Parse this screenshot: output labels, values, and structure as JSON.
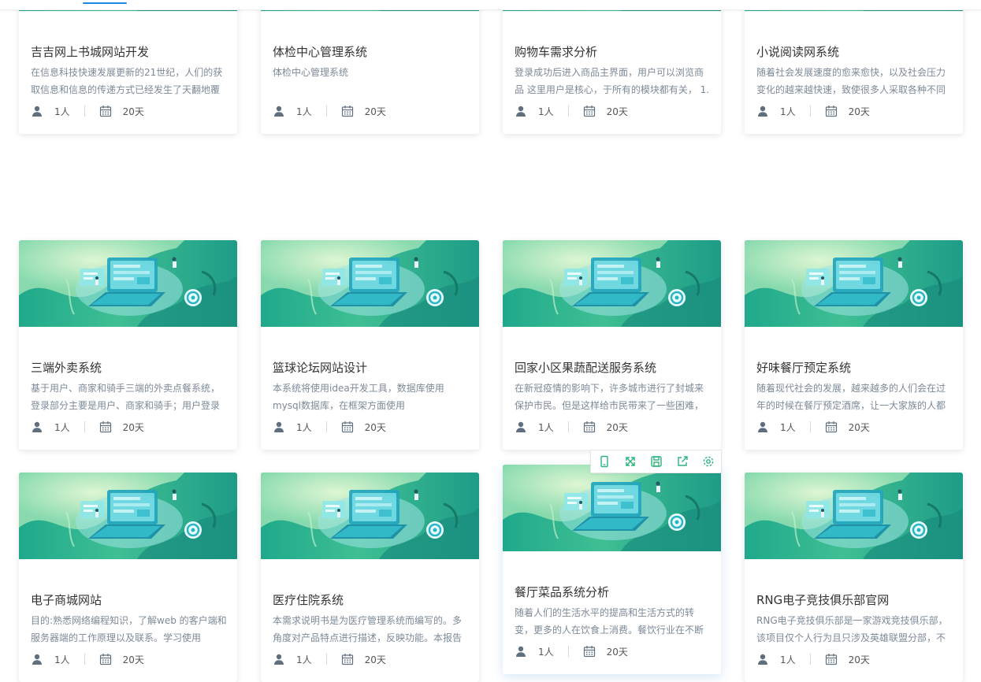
{
  "colors": {
    "accent": "#1e88e5",
    "banner_teal": "#21a98c",
    "banner_light": "#b7ecc6",
    "title_text": "#333333",
    "desc_text": "#7d8a97",
    "toolbar_icon": "#2bb37d"
  },
  "meta_icons": {
    "members": "user-icon",
    "duration": "calendar-icon"
  },
  "hover_toolbar": {
    "icons": [
      "tablet-icon",
      "fullscreen-icon",
      "save-icon",
      "share-icon",
      "settings-icon"
    ]
  },
  "cards": [
    {
      "title": "吉吉网上书城网站开发",
      "desc": "在信息科技快速发展更新的21世纪，人们的获取信息和信息的传递方式已经发生了天翻地覆",
      "members": "1人",
      "days": "20天"
    },
    {
      "title": "体检中心管理系统",
      "desc": "体检中心管理系统",
      "members": "1人",
      "days": "20天"
    },
    {
      "title": "购物车需求分析",
      "desc": "登录成功后进入商品主界面，用户可以浏览商品 这里用户是核心，于所有的模块都有关， 1.",
      "members": "1人",
      "days": "20天"
    },
    {
      "title": "小说阅读网系统",
      "desc": "随着社会发展速度的愈来愈快，以及社会压力变化的越来越快速，致使很多人采取各种不同",
      "members": "1人",
      "days": "20天"
    },
    {
      "title": "三端外卖系统",
      "desc": "基于用户、商家和骑手三端的外卖点餐系统，登录部分主要是用户、商家和骑手；用户登录",
      "members": "1人",
      "days": "20天"
    },
    {
      "title": "篮球论坛网站设计",
      "desc": "本系统将使用idea开发工具，数据库使用mysql数据库，在框架方面使用",
      "members": "1人",
      "days": "20天"
    },
    {
      "title": "回家小区果蔬配送服务系统",
      "desc": "在新冠疫情的影响下，许多城市进行了封城来保护市民。但是这样给市民带来了一些困难，",
      "members": "1人",
      "days": "20天"
    },
    {
      "title": "好味餐厅预定系统",
      "desc": "随着现代社会的发展，越来越多的人们会在过年的时候在餐厅预定酒席，让一大家族的人都",
      "members": "1人",
      "days": "20天"
    },
    {
      "title": "电子商城网站",
      "desc": "目的:熟悉网络编程知识，了解web 的客户端和服务器端的工作原理以及联系。学习使用",
      "members": "1人",
      "days": "20天"
    },
    {
      "title": "医疗住院系统",
      "desc": "本需求说明书是为医疗管理系统而编写的。多角度对产品特点进行描述，反映功能。本报告",
      "members": "1人",
      "days": "20天"
    },
    {
      "title": "餐厅菜品系统分析",
      "desc": "随着人们的生活水平的提高和生活方式的转变，更多的人在饮食上消费。餐饮行业在不断",
      "members": "1人",
      "days": "20天"
    },
    {
      "title": "RNG电子竞技俱乐部官网",
      "desc": "RNG电子竞技俱乐部是一家游戏竞技俱乐部，该项目仅个人行为且只涉及英雄联盟分部，不",
      "members": "1人",
      "days": "20天"
    }
  ]
}
